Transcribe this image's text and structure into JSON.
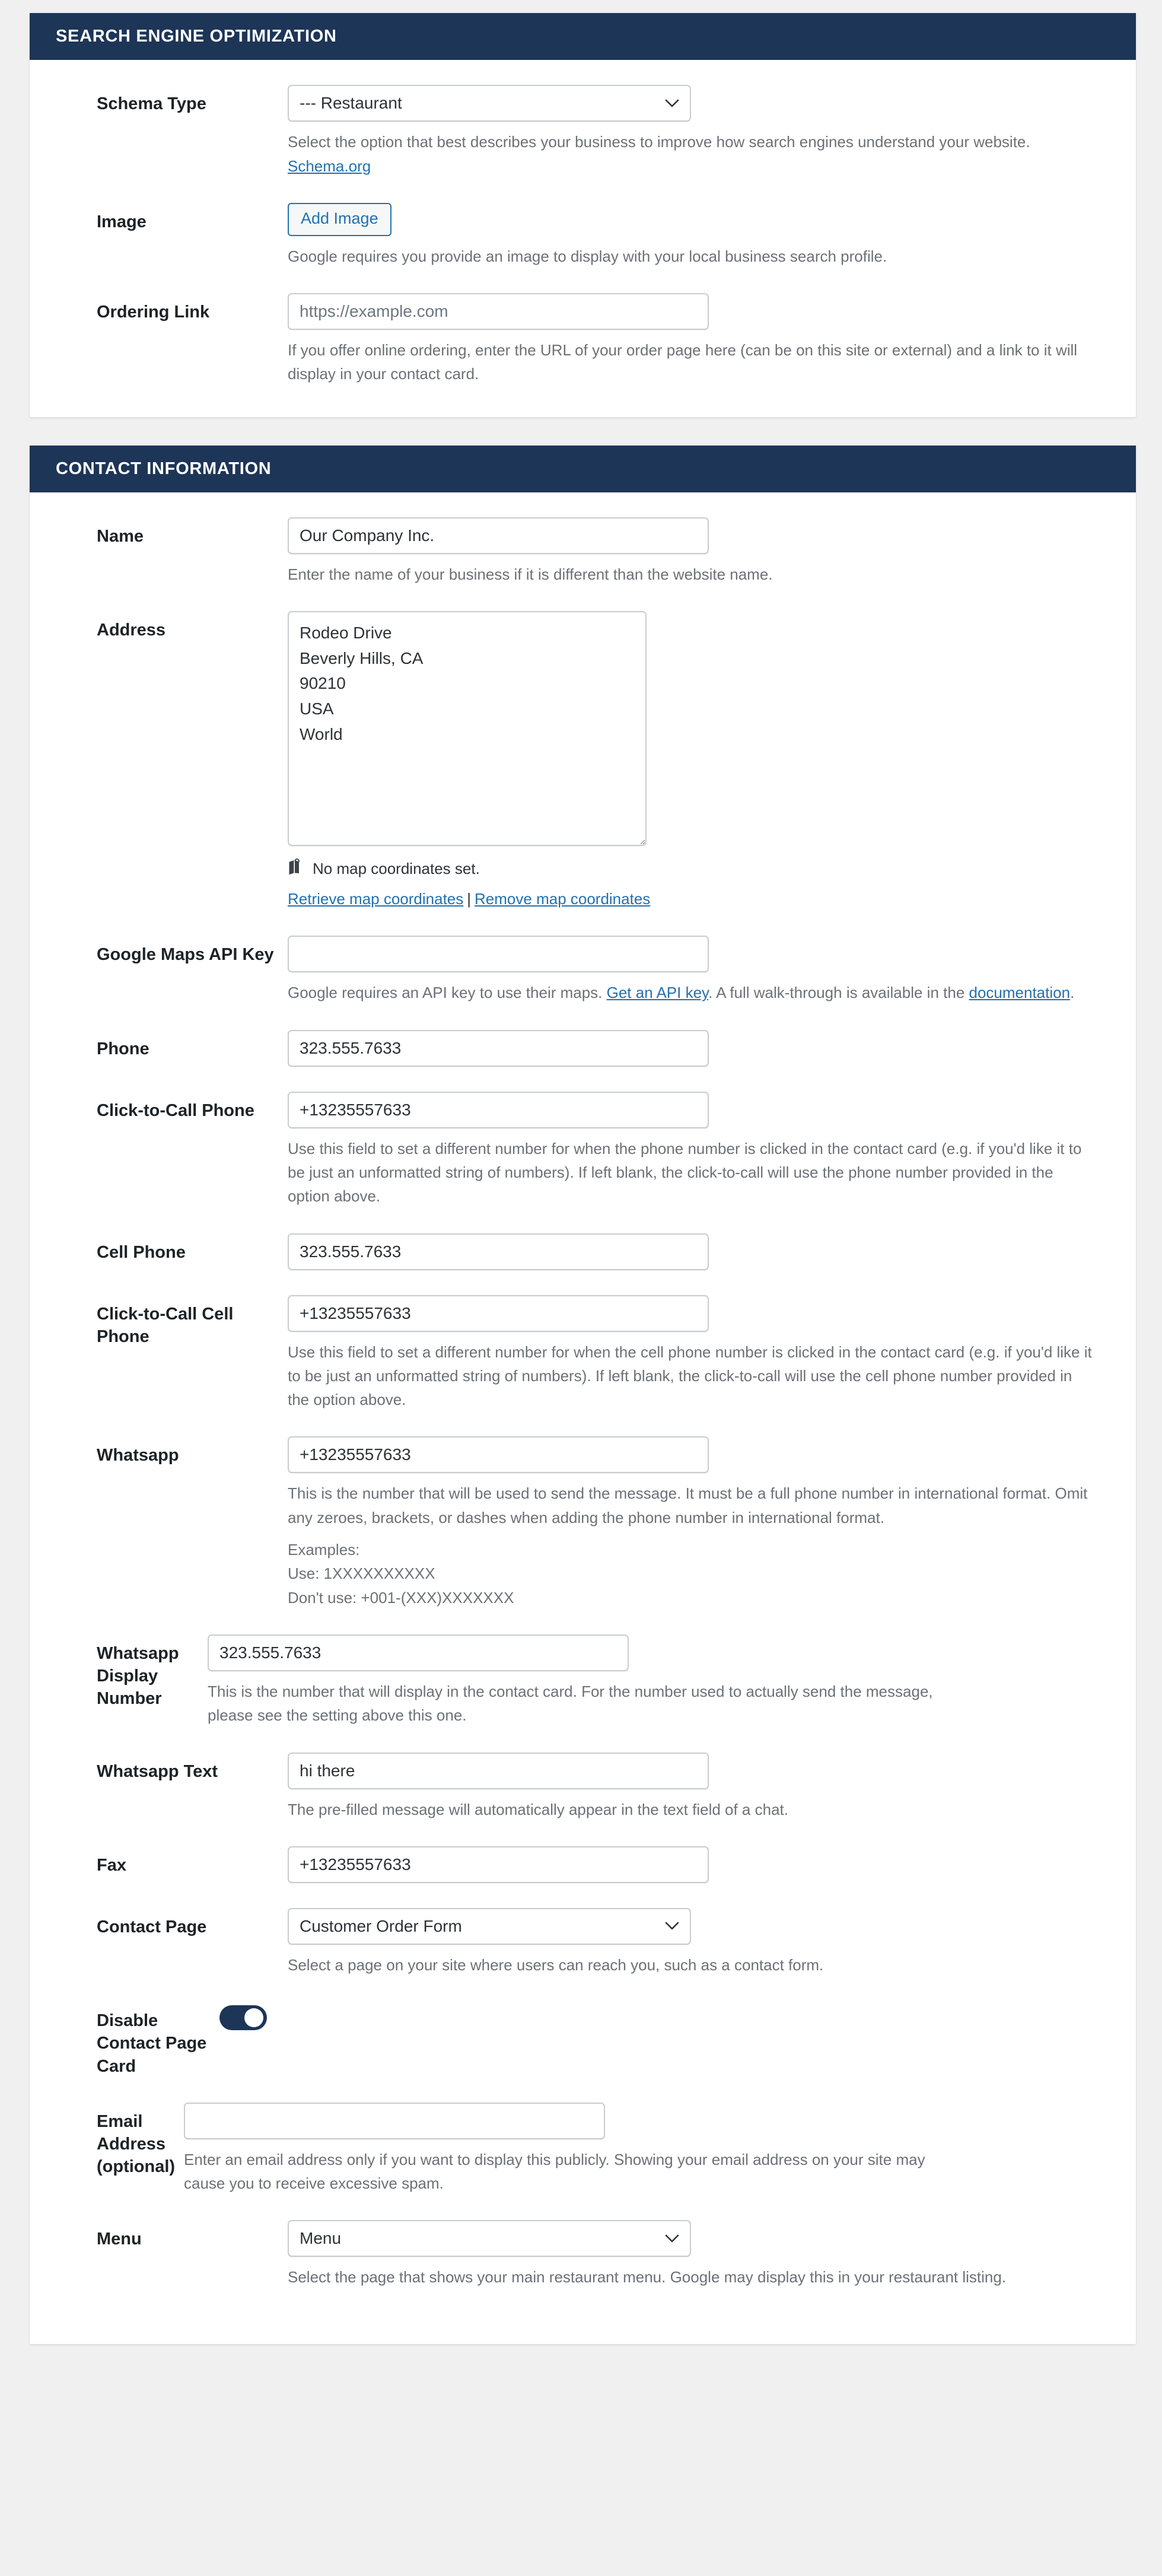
{
  "sections": [
    {
      "id": "seo",
      "title": "SEARCH ENGINE OPTIMIZATION",
      "fields": [
        {
          "label": "Schema Type",
          "type": "select",
          "value": "--- Restaurant",
          "help_before": "Select the option that best describes your business to improve how search engines understand your website. ",
          "help_link": "Schema.org",
          "help_after": ""
        },
        {
          "label": "Image",
          "type": "button",
          "button_label": "Add Image",
          "help": "Google requires you provide an image to display with your local business search profile."
        },
        {
          "label": "Ordering Link",
          "type": "text",
          "value": "",
          "placeholder": "https://example.com",
          "help": "If you offer online ordering, enter the URL of your order page here (can be on this site or external) and a link to it will display in your contact card."
        }
      ]
    },
    {
      "id": "contact",
      "title": "CONTACT INFORMATION",
      "fields": [
        {
          "label": "Name",
          "type": "text",
          "value": "Our Company Inc.",
          "placeholder": "",
          "help": "Enter the name of your business if it is different than the website name."
        },
        {
          "label": "Address",
          "type": "textarea",
          "value": "Rodeo Drive\nBeverly Hills, CA\n90210\nUSA\nWorld",
          "map_icon": "map-pin-icon",
          "map_status": "No map coordinates set.",
          "map_link_retrieve": "Retrieve map coordinates",
          "map_link_separator": "|",
          "map_link_remove": "Remove map coordinates"
        },
        {
          "label": "Google Maps API Key",
          "type": "text",
          "value": "",
          "placeholder": "",
          "help_before": "Google requires an API key to use their maps. ",
          "help_link": "Get an API key",
          "help_mid": ". A full walk-through is available in the ",
          "help_link2": "documentation",
          "help_after": "."
        },
        {
          "label": "Phone",
          "type": "text",
          "value": "323.555.7633",
          "placeholder": "",
          "help": ""
        },
        {
          "label": "Click-to-Call Phone",
          "type": "text",
          "value": "+13235557633",
          "placeholder": "",
          "help": "Use this field to set a different number for when the phone number is clicked in the contact card (e.g. if you'd like it to be just an unformatted string of numbers). If left blank, the click-to-call will use the phone number provided in the option above."
        },
        {
          "label": "Cell Phone",
          "type": "text",
          "value": "323.555.7633",
          "placeholder": "",
          "help": ""
        },
        {
          "label": "Click-to-Call Cell Phone",
          "type": "text",
          "value": "+13235557633",
          "placeholder": "",
          "help": "Use this field to set a different number for when the cell phone number is clicked in the contact card (e.g. if you'd like it to be just an unformatted string of numbers). If left blank, the click-to-call will use the cell phone number provided in the option above."
        },
        {
          "label": "Whatsapp",
          "type": "text",
          "value": "+13235557633",
          "placeholder": "",
          "help": "This is the number that will be used to send the message. It must be a full phone number in international format. Omit any zeroes, brackets, or dashes when adding the phone number in international format.",
          "help_extra_lines": [
            "Examples:",
            "Use: 1XXXXXXXXXX",
            "Don't use: +001-(XXX)XXXXXXX"
          ]
        },
        {
          "label": "Whatsapp Display Number",
          "type": "text",
          "value": "323.555.7633",
          "placeholder": "",
          "help": "This is the number that will display in the contact card. For the number used to actually send the message, please see the setting above this one."
        },
        {
          "label": "Whatsapp Text",
          "type": "text",
          "value": "hi there",
          "placeholder": "",
          "help": "The pre-filled message will automatically appear in the text field of a chat."
        },
        {
          "label": "Fax",
          "type": "text",
          "value": "+13235557633",
          "placeholder": "",
          "help": ""
        },
        {
          "label": "Contact Page",
          "type": "select",
          "value": "Customer Order Form",
          "help": "Select a page on your site where users can reach you, such as a contact form."
        },
        {
          "label": "Disable Contact Page Card",
          "type": "toggle",
          "value": "on"
        },
        {
          "label": "Email Address (optional)",
          "type": "text",
          "value": "",
          "placeholder": "",
          "help": "Enter an email address only if you want to display this publicly. Showing your email address on your site may cause you to receive excessive spam."
        },
        {
          "label": "Menu",
          "type": "select",
          "value": "Menu",
          "help": "Select the page that shows your main restaurant menu. Google may display this in your restaurant listing."
        }
      ]
    }
  ],
  "colors": {
    "header_bg": "#1d3557",
    "link": "#2271b1",
    "toggle_on": "#1d3557",
    "help_text": "#6c7178"
  }
}
